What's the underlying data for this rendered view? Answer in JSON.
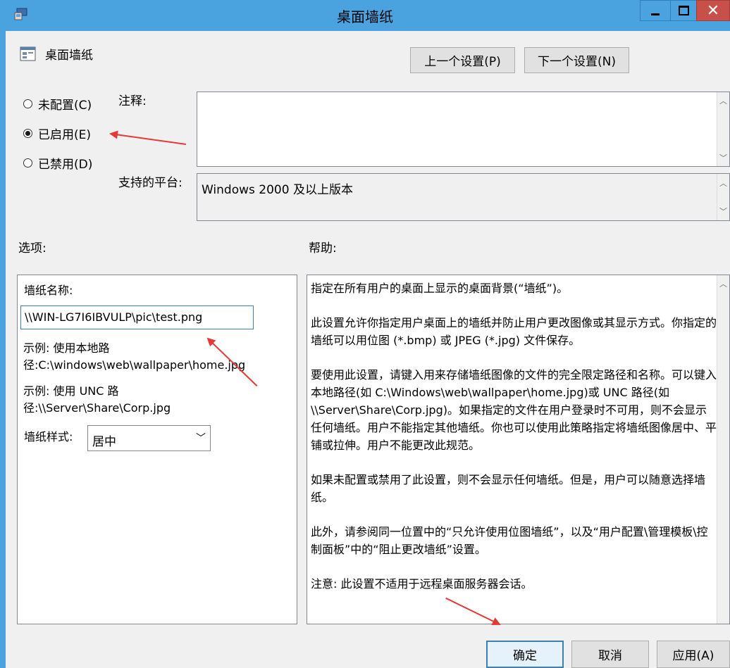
{
  "window": {
    "title": "桌面墙纸"
  },
  "setting": {
    "name": "桌面墙纸"
  },
  "nav": {
    "prev_label": "上一个设置(P)",
    "next_label": "下一个设置(N)"
  },
  "state": {
    "options": [
      {
        "label": "未配置(C)",
        "checked": false
      },
      {
        "label": "已启用(E)",
        "checked": true
      },
      {
        "label": "已禁用(D)",
        "checked": false
      }
    ]
  },
  "comment": {
    "label": "注释:",
    "value": ""
  },
  "platform": {
    "label": "支持的平台:",
    "value": "Windows 2000 及以上版本"
  },
  "options_panel": {
    "header": "选项:",
    "wallpaper_name_label": "墙纸名称:",
    "wallpaper_path": "\\\\WIN-LG7I6IBVULP\\pic\\test.png",
    "example1": "示例: 使用本地路径:C:\\windows\\web\\wallpaper\\home.jpg",
    "example2": "示例: 使用 UNC 路径:\\\\Server\\Share\\Corp.jpg",
    "style_label": "墙纸样式:",
    "style_value": "居中"
  },
  "help_panel": {
    "header": "帮助:",
    "paragraphs": [
      "指定在所有用户的桌面上显示的桌面背景(“墙纸”)。",
      "此设置允许你指定用户桌面上的墙纸并防止用户更改图像或其显示方式。你指定的墙纸可以用位图 (*.bmp) 或 JPEG (*.jpg) 文件保存。",
      "要使用此设置，请键入用来存储墙纸图像的文件的完全限定路径和名称。可以键入本地路径(如 C:\\Windows\\web\\wallpaper\\home.jpg)或 UNC 路径(如 \\\\Server\\Share\\Corp.jpg)。如果指定的文件在用户登录时不可用，则不会显示任何墙纸。用户不能指定其他墙纸。你也可以使用此策略指定将墙纸图像居中、平铺或拉伸。用户不能更改此规范。",
      "如果未配置或禁用了此设置，则不会显示任何墙纸。但是，用户可以随意选择墙纸。",
      "此外，请参阅同一位置中的“只允许使用位图墙纸”，以及“用户配置\\管理模板\\控制面板”中的“阻止更改墙纸”设置。",
      "注意: 此设置不适用于远程桌面服务器会话。"
    ]
  },
  "footer": {
    "ok_label": "确定",
    "cancel_label": "取消",
    "apply_label": "应用(A)"
  }
}
